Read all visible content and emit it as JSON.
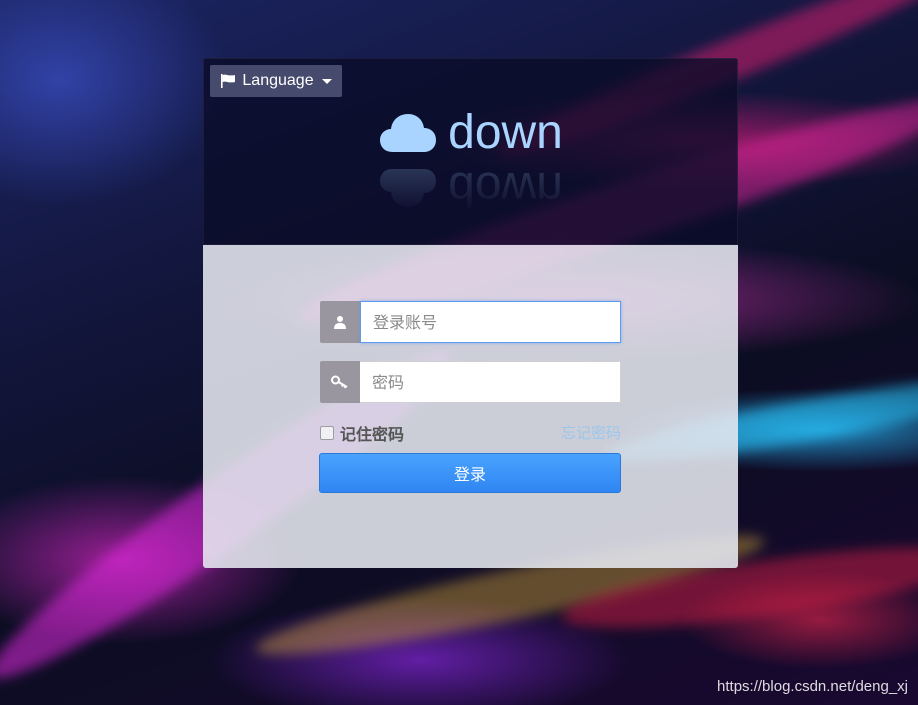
{
  "header": {
    "language_label": "Language",
    "logo_text": "down"
  },
  "login": {
    "username_placeholder": "登录账号",
    "password_placeholder": "密码",
    "remember_label": "记住密码",
    "forgot_label": "忘记密码",
    "submit_label": "登录"
  },
  "watermark": "https://blog.csdn.net/deng_xj",
  "colors": {
    "accent": "#3b8ff7",
    "logo": "#a8d4ff",
    "link": "#9cc7ec"
  }
}
